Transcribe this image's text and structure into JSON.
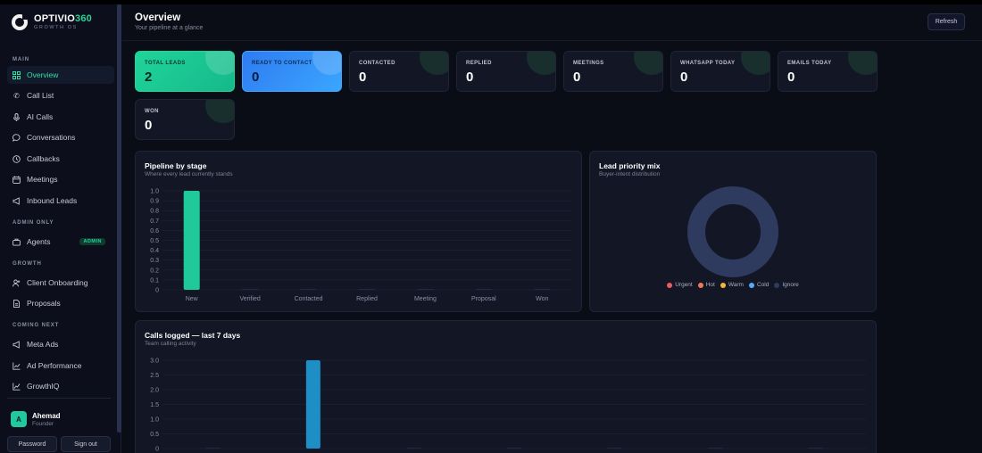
{
  "brand": {
    "name_main": "OPTIVIO",
    "name_num": "360",
    "tagline": "GROWTH OS"
  },
  "sidebar": {
    "sections": [
      {
        "label": "MAIN"
      },
      {
        "label": "ADMIN ONLY"
      },
      {
        "label": "GROWTH"
      },
      {
        "label": "COMING NEXT"
      }
    ],
    "items": [
      {
        "label": "Overview",
        "icon": "grid-icon",
        "active": true
      },
      {
        "label": "Call List",
        "icon": "phone-icon"
      },
      {
        "label": "AI Calls",
        "icon": "mic-icon"
      },
      {
        "label": "Conversations",
        "icon": "chat-bubble-icon"
      },
      {
        "label": "Callbacks",
        "icon": "clock-icon"
      },
      {
        "label": "Meetings",
        "icon": "calendar-icon"
      },
      {
        "label": "Inbound Leads",
        "icon": "megaphone-icon"
      },
      {
        "label": "Agents",
        "icon": "briefcase-icon",
        "badge": "ADMIN"
      },
      {
        "label": "Client Onboarding",
        "icon": "user-plus-icon"
      },
      {
        "label": "Proposals",
        "icon": "document-icon"
      },
      {
        "label": "Meta Ads",
        "icon": "megaphone-icon"
      },
      {
        "label": "Ad Performance",
        "icon": "line-chart-icon"
      },
      {
        "label": "GrowthIQ",
        "icon": "trend-icon"
      }
    ]
  },
  "user": {
    "initial": "A",
    "name": "Ahemad",
    "role": "Founder"
  },
  "footer_buttons": {
    "password": "Password",
    "signout": "Sign out"
  },
  "header": {
    "title": "Overview",
    "subtitle": "Your pipeline at a glance",
    "refresh": "Refresh"
  },
  "kpis": [
    {
      "label": "TOTAL LEADS",
      "value": "2",
      "style": "green"
    },
    {
      "label": "READY TO CONTACT",
      "value": "0",
      "style": "blue"
    },
    {
      "label": "CONTACTED",
      "value": "0"
    },
    {
      "label": "REPLIED",
      "value": "0"
    },
    {
      "label": "MEETINGS",
      "value": "0"
    },
    {
      "label": "WHATSAPP TODAY",
      "value": "0"
    },
    {
      "label": "EMAILS TODAY",
      "value": "0"
    },
    {
      "label": "WON",
      "value": "0"
    }
  ],
  "pipeline_panel": {
    "title": "Pipeline by stage",
    "subtitle": "Where every lead currently stands"
  },
  "priority_panel": {
    "title": "Lead priority mix",
    "subtitle": "Buyer-intent distribution",
    "legend": [
      {
        "label": "Urgent",
        "color": "#ef5b5b"
      },
      {
        "label": "Hot",
        "color": "#f07a55"
      },
      {
        "label": "Warm",
        "color": "#f5b73b"
      },
      {
        "label": "Cold",
        "color": "#5aa9f7"
      },
      {
        "label": "Ignore",
        "color": "#2e3a5e"
      }
    ]
  },
  "calls_panel": {
    "title": "Calls logged — last 7 days",
    "subtitle": "Team calling activity"
  },
  "chart_data": [
    {
      "type": "bar",
      "categories": [
        "New",
        "Verified",
        "Contacted",
        "Replied",
        "Meeting",
        "Proposal",
        "Won"
      ],
      "values": [
        1,
        0,
        0,
        0,
        0,
        0,
        0
      ],
      "ylim": [
        0,
        1.0
      ],
      "yticks": [
        "1.0",
        "0.9",
        "0.8",
        "0.7",
        "0.6",
        "0.5",
        "0.4",
        "0.3",
        "0.2",
        "0.1",
        "0"
      ],
      "color": "#1fc99a",
      "grid": true
    },
    {
      "type": "pie",
      "categories": [
        "Urgent",
        "Hot",
        "Warm",
        "Cold",
        "Ignore"
      ],
      "values": [
        0,
        0,
        0,
        0,
        0
      ],
      "colors": [
        "#ef5b5b",
        "#f07a55",
        "#f5b73b",
        "#5aa9f7",
        "#2e3a5e"
      ]
    },
    {
      "type": "bar",
      "values": [
        0,
        3,
        0,
        0,
        0,
        0,
        0
      ],
      "ylim": [
        0,
        3.0
      ],
      "yticks": [
        "3.0",
        "2.5",
        "2.0",
        "1.5",
        "1.0",
        "0.5",
        "0"
      ],
      "color": "#1e8fc6",
      "grid": true
    }
  ]
}
